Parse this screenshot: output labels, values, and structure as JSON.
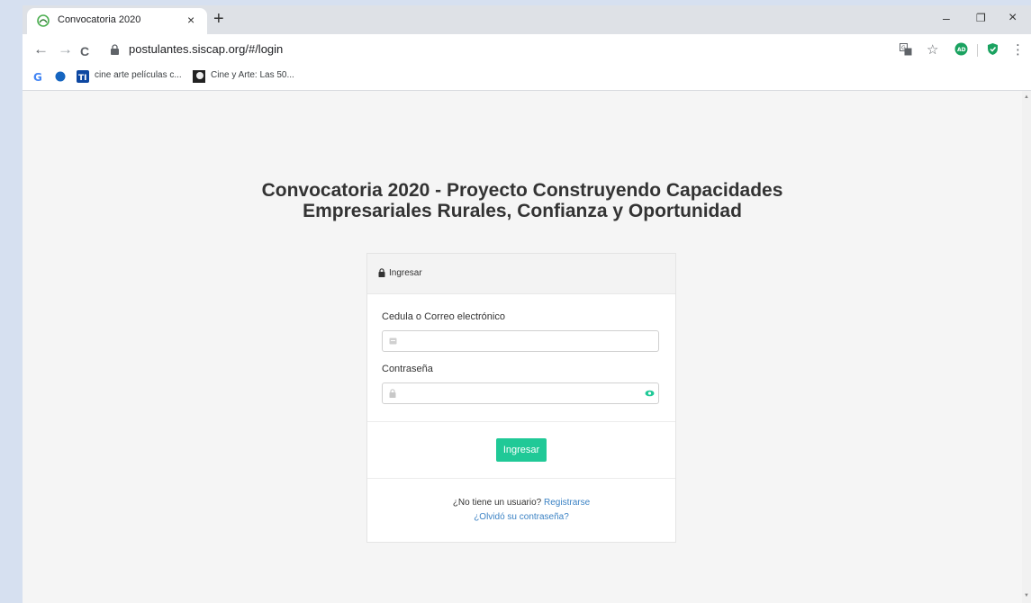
{
  "browser": {
    "tab_title": "Convocatoria 2020",
    "tab_close": "×",
    "new_tab": "+",
    "url": "postulantes.siscap.org/#/login",
    "window_controls": {
      "minimize": "–",
      "restore": "❐",
      "close": "×"
    },
    "toolbar": {
      "back": "←",
      "forward": "→",
      "reload": "C",
      "star": "☆",
      "menu": "⋮",
      "extension_label": "AD"
    },
    "bookmarks": [
      {
        "icon": "google-icon",
        "label": ""
      },
      {
        "icon": "circle-icon",
        "label": ""
      },
      {
        "icon": "ti-icon",
        "label": "cine arte películas c..."
      },
      {
        "icon": "cine-icon",
        "label": "Cine y Arte: Las 50..."
      }
    ]
  },
  "page": {
    "heading_line1": "Convocatoria 2020 - Proyecto Construyendo Capacidades",
    "heading_line2": "Empresariales Rurales, Confianza y Oportunidad",
    "card": {
      "header_title": "Ingresar",
      "username_label": "Cedula o Correo electrónico",
      "username_value": "",
      "password_label": "Contraseña",
      "password_value": "",
      "submit_label": "Ingresar",
      "no_user_text": "¿No tiene un usuario?",
      "register_link": "Registrarse",
      "forgot_link": "¿Olvidó su contraseña?"
    }
  },
  "colors": {
    "accent_button": "#20c997",
    "link": "#3b82c4",
    "page_background": "#f5f5f5"
  }
}
